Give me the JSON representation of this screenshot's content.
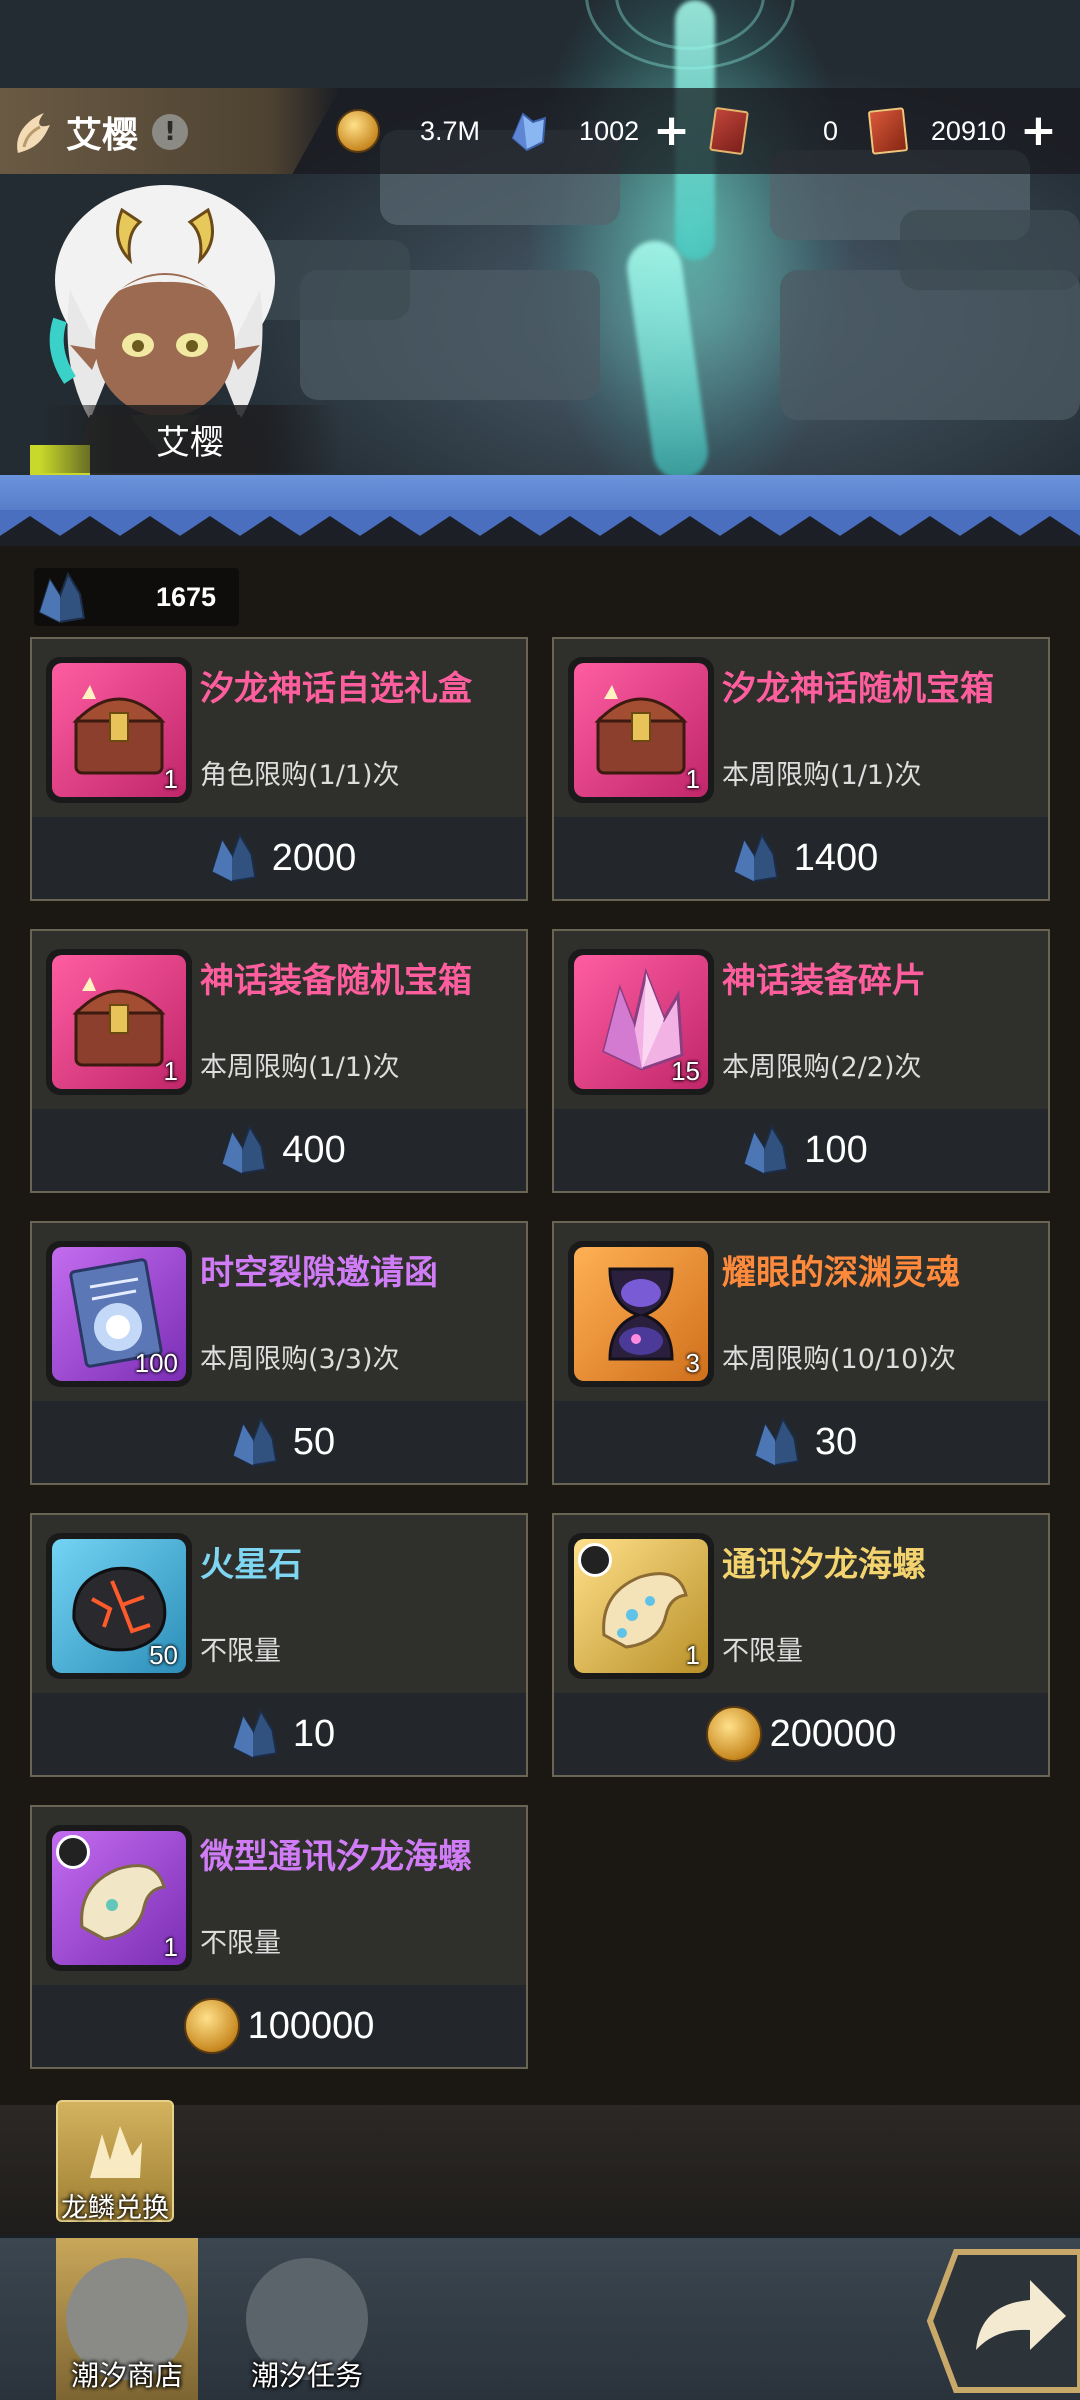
{
  "header": {
    "character_name": "艾樱",
    "portrait_name": "艾樱",
    "resources": [
      {
        "icon": "gold-coin-icon",
        "value": "3.7M",
        "has_plus": false
      },
      {
        "icon": "blue-crystal-icon",
        "value": "1002",
        "has_plus": true
      },
      {
        "icon": "red-ticket-icon",
        "value": "0",
        "has_plus": false
      },
      {
        "icon": "red-card-icon",
        "value": "20910",
        "has_plus": true
      }
    ]
  },
  "shop": {
    "currency_icon": "dragon-scale-icon",
    "currency_value": "1675",
    "items": [
      {
        "title": "汐龙神话自选礼盒",
        "limit": "角色限购(1/1)次",
        "qty": "1",
        "price": "2000",
        "price_icon": "dragon-scale-icon",
        "icon": "treasure-chest-icon",
        "title_color": "#ff5e9e",
        "frame": "pink"
      },
      {
        "title": "汐龙神话随机宝箱",
        "limit": "本周限购(1/1)次",
        "qty": "1",
        "price": "1400",
        "price_icon": "dragon-scale-icon",
        "icon": "treasure-chest-icon",
        "title_color": "#ff5e9e",
        "frame": "pink"
      },
      {
        "title": "神话装备随机宝箱",
        "limit": "本周限购(1/1)次",
        "qty": "1",
        "price": "400",
        "price_icon": "dragon-scale-icon",
        "icon": "treasure-chest-icon",
        "title_color": "#ff5e9e",
        "frame": "pink"
      },
      {
        "title": "神话装备碎片",
        "limit": "本周限购(2/2)次",
        "qty": "15",
        "price": "100",
        "price_icon": "dragon-scale-icon",
        "icon": "pink-crystal-icon",
        "title_color": "#ff5e9e",
        "frame": "pink"
      },
      {
        "title": "时空裂隙邀请函",
        "limit": "本周限购(3/3)次",
        "qty": "100",
        "price": "50",
        "price_icon": "dragon-scale-icon",
        "icon": "invitation-scroll-icon",
        "title_color": "#d07cf6",
        "frame": "purple"
      },
      {
        "title": "耀眼的深渊灵魂",
        "limit": "本周限购(10/10)次",
        "qty": "3",
        "price": "30",
        "price_icon": "dragon-scale-icon",
        "icon": "hourglass-soul-icon",
        "title_color": "#ff8a3c",
        "frame": "orange"
      },
      {
        "title": "火星石",
        "limit": "不限量",
        "qty": "50",
        "price": "10",
        "price_icon": "dragon-scale-icon",
        "icon": "mars-stone-icon",
        "title_color": "#7fd6f2",
        "frame": "blue"
      },
      {
        "title": "通讯汐龙海螺",
        "limit": "不限量",
        "qty": "1",
        "price": "200000",
        "price_icon": "gold-coin-icon",
        "icon": "conch-shell-icon",
        "title_color": "#f2d36e",
        "frame": "gold"
      },
      {
        "title": "微型通讯汐龙海螺",
        "limit": "不限量",
        "qty": "1",
        "price": "100000",
        "price_icon": "gold-coin-icon",
        "icon": "conch-shell-icon",
        "title_color": "#d07cf6",
        "frame": "purple"
      }
    ]
  },
  "bottom": {
    "exchange_label": "龙鳞兑换",
    "tabs": [
      {
        "label": "潮汐商店",
        "selected": true
      },
      {
        "label": "潮汐任务",
        "selected": false
      }
    ],
    "back_icon": "return-arrow-icon"
  }
}
